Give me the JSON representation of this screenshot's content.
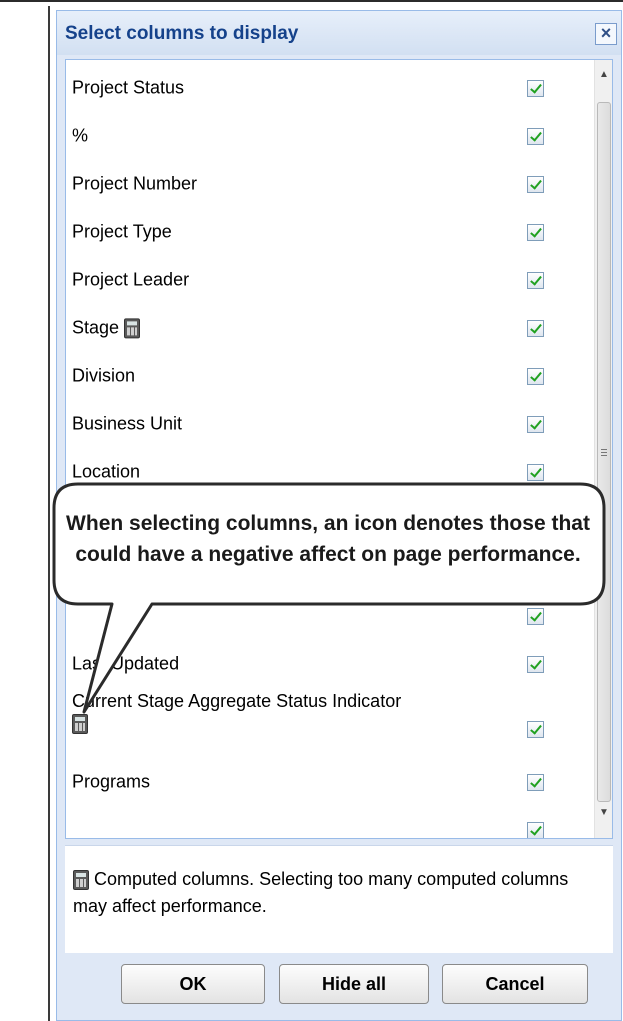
{
  "dialog": {
    "title": "Select columns to display",
    "close_label": "×"
  },
  "columns": [
    {
      "label": "Project Status",
      "checked": true
    },
    {
      "label": "%",
      "checked": true
    },
    {
      "label": "Project Number",
      "checked": true
    },
    {
      "label": "Project Type",
      "checked": true
    },
    {
      "label": "Project Leader",
      "checked": true
    },
    {
      "label": "Stage",
      "checked": true,
      "icon": "calculator-icon"
    },
    {
      "label": "Division",
      "checked": true
    },
    {
      "label": "Business Unit",
      "checked": true
    },
    {
      "label": "Location",
      "checked": true
    },
    {
      "label": "Last Updated",
      "checked": true
    },
    {
      "label": "Current Stage Aggregate Status Indicator",
      "checked": true,
      "icon": "calculator-icon"
    },
    {
      "label": "Programs",
      "checked": true
    }
  ],
  "note": {
    "icon": "calculator-icon",
    "text": "Computed columns. Selecting too many computed columns may affect performance."
  },
  "buttons": {
    "ok": "OK",
    "hide_all": "Hide all",
    "cancel": "Cancel"
  },
  "callout": {
    "text": "When selecting columns, an icon denotes those that could have a negative affect on page performance."
  }
}
